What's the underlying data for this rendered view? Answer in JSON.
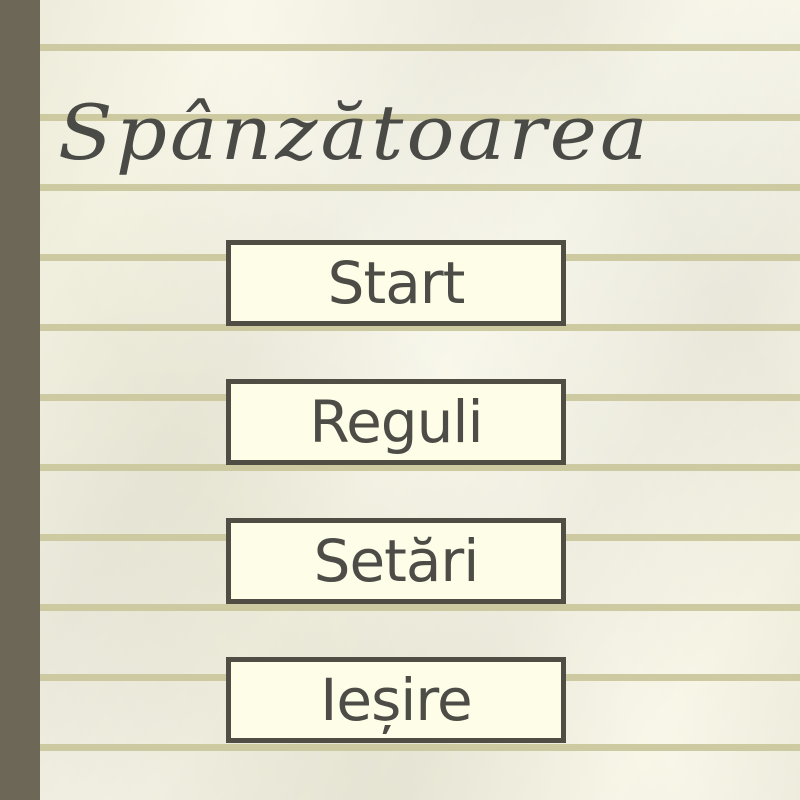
{
  "game": {
    "title": "Spânzătoarea"
  },
  "menu": {
    "start_label": "Start",
    "rules_label": "Reguli",
    "settings_label": "Setări",
    "exit_label": "Ieșire"
  },
  "colors": {
    "paper": "#f7f5e3",
    "rule_lines": "#cdc9a0",
    "margin_bar": "#6d6757",
    "button_fill": "#fdfde8",
    "button_border": "#504d45",
    "text": "#4d4c47"
  }
}
